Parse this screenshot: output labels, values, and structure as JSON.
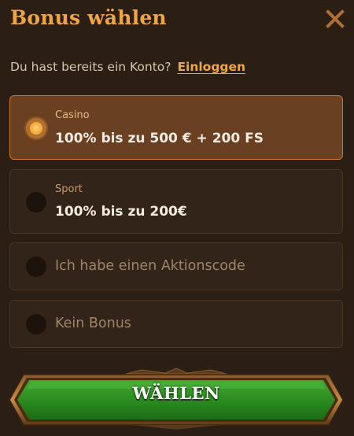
{
  "header": {
    "title": "Bonus wählen",
    "close_icon": "close-x-icon"
  },
  "account": {
    "prompt": "Du hast bereits ein Konto?",
    "login_link": "Einloggen"
  },
  "options": [
    {
      "category": "Casino",
      "label": "100% bis zu 500 € + 200 FS",
      "selected": true
    },
    {
      "category": "Sport",
      "label": "100% bis zu 200€",
      "selected": false
    },
    {
      "label": "Ich habe einen Aktionscode",
      "selected": false
    },
    {
      "label": "Kein Bonus",
      "selected": false
    }
  ],
  "cta": {
    "label": "WÄHLEN"
  },
  "colors": {
    "accent": "#f0a545",
    "background": "#2b1e15",
    "selected_card": "#6a4120",
    "card": "#33241a",
    "button_green": "#2f8a24"
  }
}
